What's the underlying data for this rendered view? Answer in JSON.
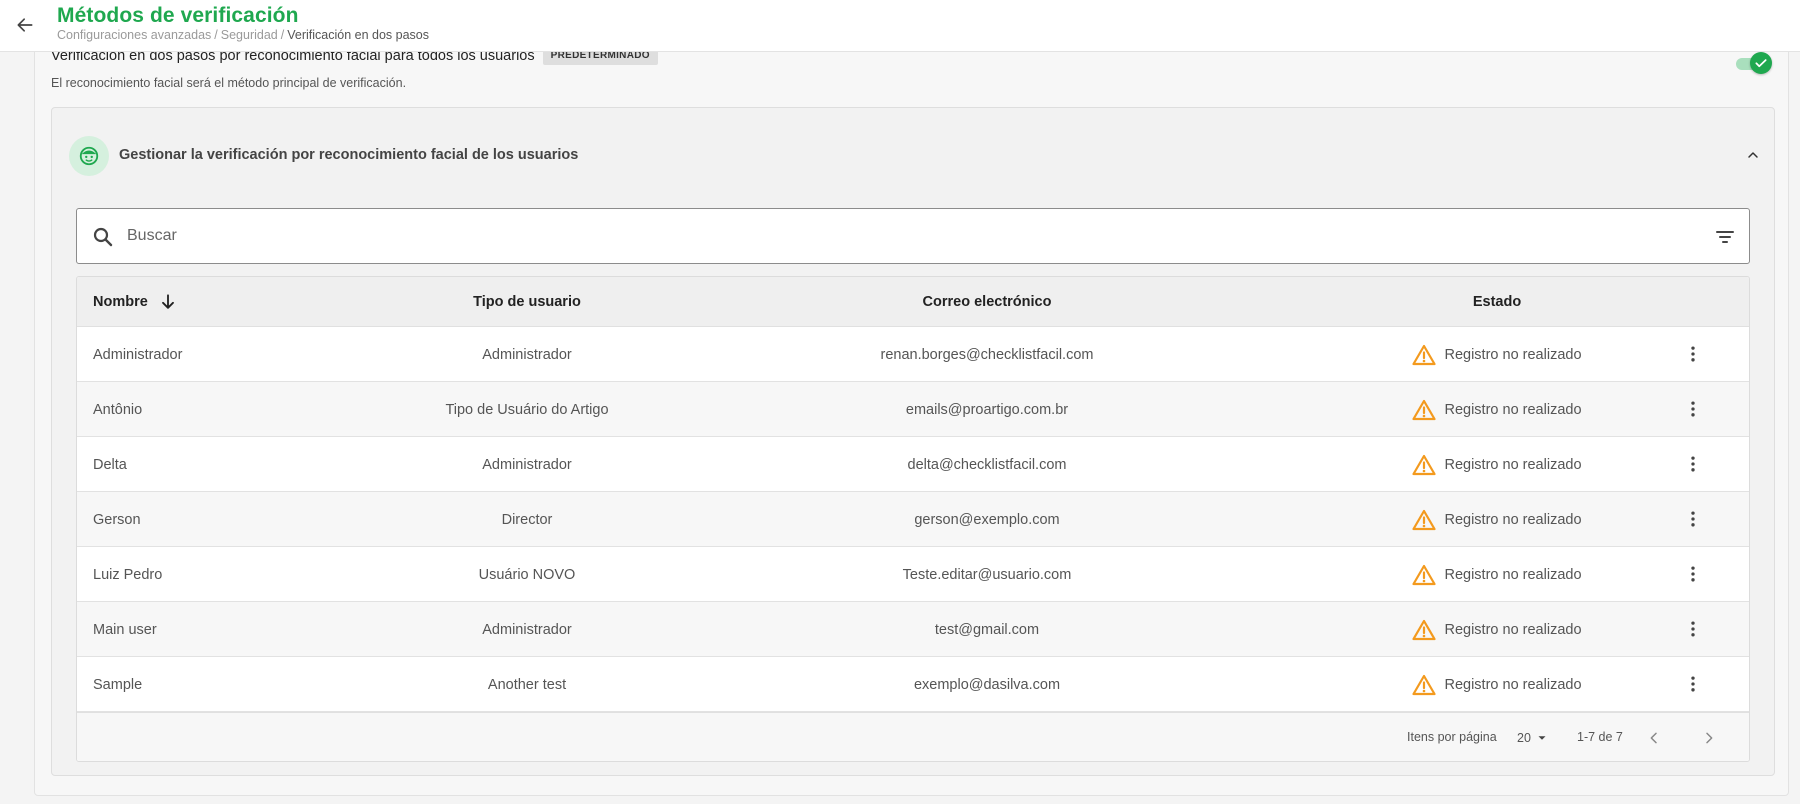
{
  "header": {
    "title": "Métodos de verificación",
    "breadcrumb": [
      "Configuraciones avanzadas",
      "Seguridad",
      "Verificación en dos pasos"
    ]
  },
  "setting": {
    "title": "Verificación en dos pasos por reconocimiento facial para todos los usuarios",
    "badge": "PREDETERMINADO",
    "description": "El reconocimiento facial será el método principal de verificación.",
    "toggle_on": true
  },
  "panel": {
    "title": "Gestionar la verificación por reconocimiento facial de los usuarios",
    "search_placeholder": "Buscar"
  },
  "table": {
    "columns": {
      "name": "Nombre",
      "type": "Tipo de usuario",
      "email": "Correo electrónico",
      "status": "Estado"
    },
    "rows": [
      {
        "name": "Administrador",
        "type": "Administrador",
        "email": "renan.borges@checklistfacil.com",
        "status": "Registro no realizado"
      },
      {
        "name": "Antônio",
        "type": "Tipo de Usuário do Artigo",
        "email": "emails@proartigo.com.br",
        "status": "Registro no realizado"
      },
      {
        "name": "Delta",
        "type": "Administrador",
        "email": "delta@checklistfacil.com",
        "status": "Registro no realizado"
      },
      {
        "name": "Gerson",
        "type": "Director",
        "email": "gerson@exemplo.com",
        "status": "Registro no realizado"
      },
      {
        "name": "Luiz Pedro",
        "type": "Usuário NOVO",
        "email": "Teste.editar@usuario.com",
        "status": "Registro no realizado"
      },
      {
        "name": "Main user",
        "type": "Administrador",
        "email": "test@gmail.com",
        "status": "Registro no realizado"
      },
      {
        "name": "Sample",
        "type": "Another test",
        "email": "exemplo@dasilva.com",
        "status": "Registro no realizado"
      }
    ],
    "footer": {
      "per_page_label": "Itens por página",
      "per_page_value": "20",
      "range": "1-7 de 7"
    }
  },
  "colors": {
    "accent": "#1fa84f",
    "warning": "#f39a1e"
  }
}
